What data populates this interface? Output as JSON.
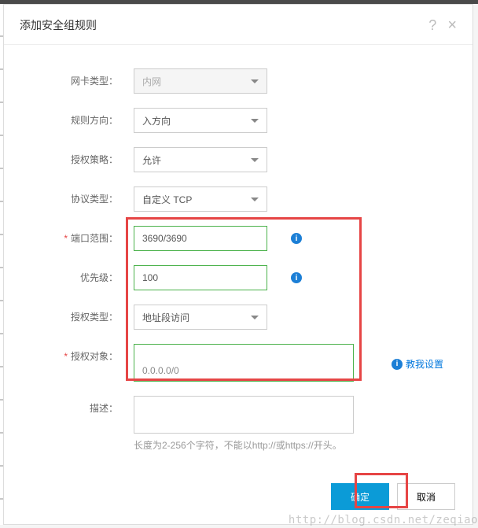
{
  "dialog": {
    "title": "添加安全组规则"
  },
  "form": {
    "nic_type": {
      "label": "网卡类型：",
      "value": "内网"
    },
    "direction": {
      "label": "规则方向：",
      "value": "入方向"
    },
    "policy": {
      "label": "授权策略：",
      "value": "允许"
    },
    "protocol": {
      "label": "协议类型：",
      "value": "自定义 TCP"
    },
    "port_range": {
      "label": "端口范围：",
      "value": "3690/3690"
    },
    "priority": {
      "label": "优先级：",
      "value": "100"
    },
    "auth_type": {
      "label": "授权类型：",
      "value": "地址段访问"
    },
    "auth_object": {
      "label": "授权对象：",
      "value": "0.0.0.0/0",
      "teach": "教我设置"
    },
    "description": {
      "label": "描述：",
      "hint": "长度为2-256个字符，不能以http://或https://开头。"
    }
  },
  "footer": {
    "ok": "确定",
    "cancel": "取消"
  },
  "watermark": "http://blog.csdn.net/zeqiao"
}
